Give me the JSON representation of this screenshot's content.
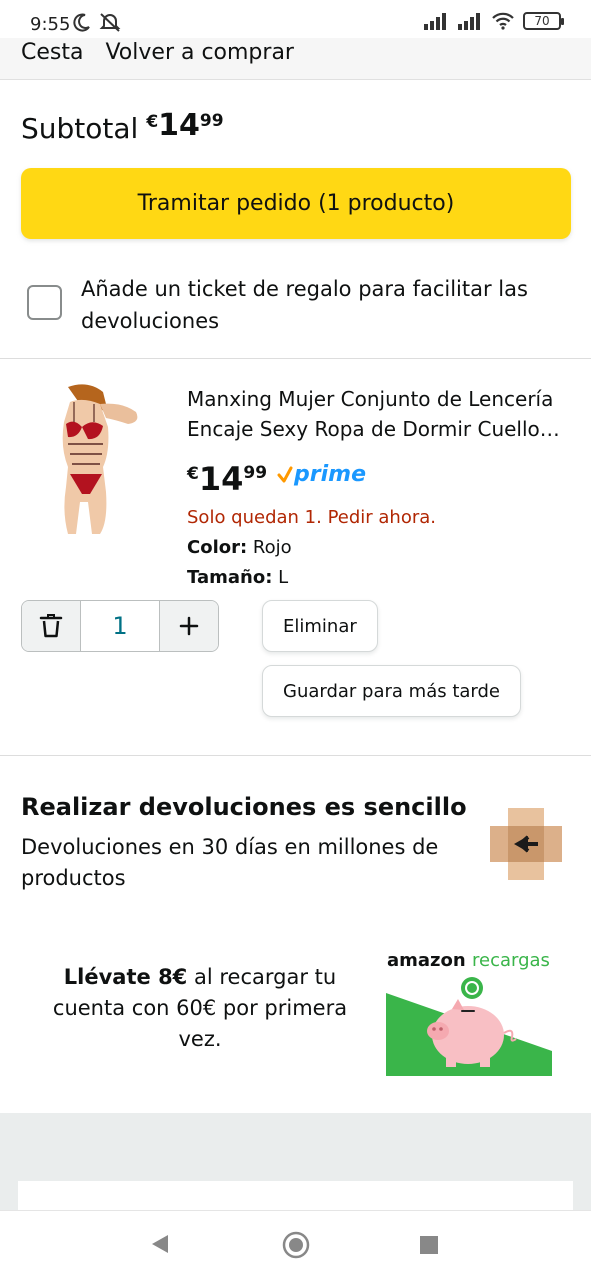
{
  "status_bar": {
    "time": "9:55",
    "battery": "70",
    "icons": [
      "moon-icon",
      "silent-icon",
      "signal-icon",
      "signal-icon",
      "wifi-icon",
      "battery-icon"
    ]
  },
  "top_nav": {
    "cart_label": "Cesta",
    "buy_again_label": "Volver a comprar"
  },
  "subtotal": {
    "label": "Subtotal",
    "currency": "€",
    "whole": "14",
    "fraction": "99"
  },
  "checkout_button": "Tramitar pedido (1 producto)",
  "gift": {
    "line1": "Añade un ticket de regalo para facilitar las",
    "line2": "devoluciones",
    "checked": false
  },
  "product": {
    "title_line1": "Manxing Mujer Conjunto de Lencería",
    "title_line2": "Encaje Sexy Ropa de Dormir Cuello…",
    "currency": "€",
    "whole": "14",
    "fraction": "99",
    "prime": "prime",
    "stock": "Solo quedan 1. Pedir ahora.",
    "color_label": "Color:",
    "color_value": "Rojo",
    "size_label": "Tamaño:",
    "size_value": "L",
    "quantity": "1",
    "delete_label": "Eliminar",
    "save_label": "Guardar para más tarde",
    "image_icon": "lingerie-product-image"
  },
  "returns": {
    "title": "Realizar devoluciones es sencillo",
    "text": "Devoluciones en 30 días en millones de productos",
    "icon": "return-box-icon"
  },
  "recarga": {
    "bold_text": "Llévate 8€",
    "text": " al recargar tu cuenta con 60€ por primera vez.",
    "logo_amazon": "amazon",
    "logo_recargas": "recargas",
    "image": "piggy-bank-image"
  },
  "colors": {
    "checkout_yellow": "#ffd814",
    "stock_red": "#b12704",
    "prime_blue": "#1a98ff",
    "quantity_teal": "#007185",
    "recarga_green": "#3ab54a"
  }
}
